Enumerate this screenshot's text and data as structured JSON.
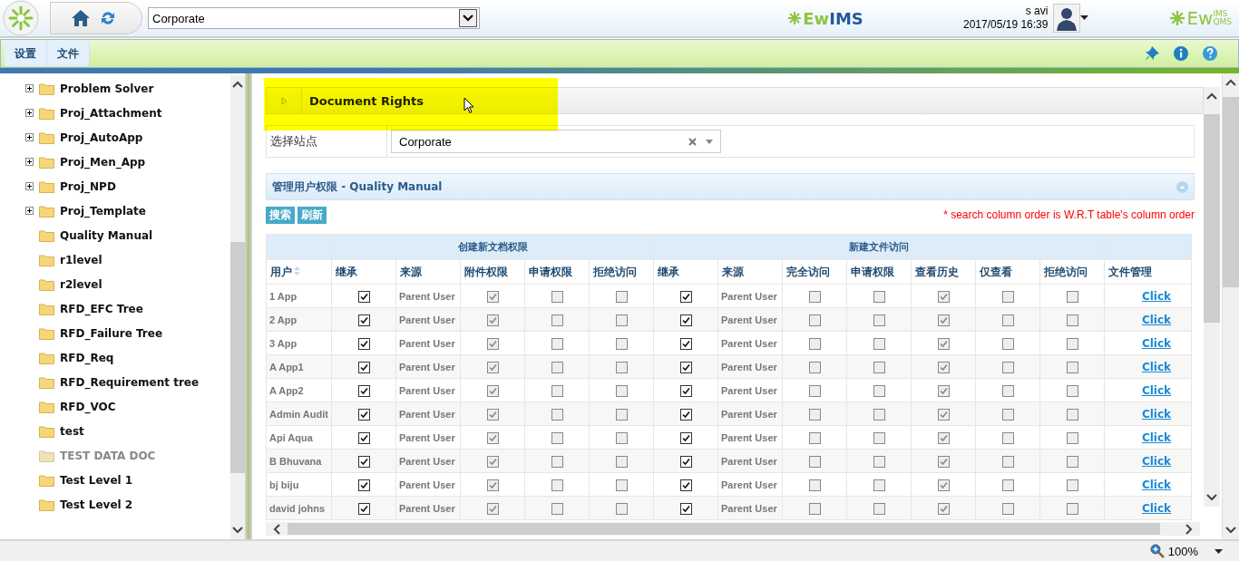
{
  "header": {
    "site_select": "Corporate",
    "user_name": "s avi",
    "datetime": "2017/05/19 16:39"
  },
  "logo_center": {
    "green": "Ew",
    "blue": "IMS"
  },
  "logo_right": {
    "word": "Ew",
    "upper": "IMS",
    "lower": "QMS"
  },
  "menu": [
    {
      "label": "设置"
    },
    {
      "label": "文件"
    }
  ],
  "tree": [
    {
      "label": "Problem Solver",
      "expandable": true,
      "dimmed": false
    },
    {
      "label": "Proj_Attachment",
      "expandable": true,
      "dimmed": false
    },
    {
      "label": "Proj_AutoApp",
      "expandable": true,
      "dimmed": false
    },
    {
      "label": "Proj_Men_App",
      "expandable": true,
      "dimmed": false
    },
    {
      "label": "Proj_NPD",
      "expandable": true,
      "dimmed": false
    },
    {
      "label": "Proj_Template",
      "expandable": true,
      "dimmed": false
    },
    {
      "label": "Quality Manual",
      "expandable": false,
      "dimmed": false
    },
    {
      "label": "r1level",
      "expandable": false,
      "dimmed": false
    },
    {
      "label": "r2level",
      "expandable": false,
      "dimmed": false
    },
    {
      "label": "RFD_EFC Tree",
      "expandable": false,
      "dimmed": false
    },
    {
      "label": "RFD_Failure Tree",
      "expandable": false,
      "dimmed": false
    },
    {
      "label": "RFD_Req",
      "expandable": false,
      "dimmed": false
    },
    {
      "label": "RFD_Requirement tree",
      "expandable": false,
      "dimmed": false
    },
    {
      "label": "RFD_VOC",
      "expandable": false,
      "dimmed": false
    },
    {
      "label": "test",
      "expandable": false,
      "dimmed": false
    },
    {
      "label": "TEST DATA DOC",
      "expandable": false,
      "dimmed": true
    },
    {
      "label": "Test Level 1",
      "expandable": false,
      "dimmed": false
    },
    {
      "label": "Test Level 2",
      "expandable": false,
      "dimmed": false
    }
  ],
  "panel": {
    "title": "Document Rights",
    "highlighted": true
  },
  "site_field": {
    "label": "选择站点",
    "value": "Corporate"
  },
  "section": {
    "title": "管理用户权限 - Quality Manual"
  },
  "buttons": [
    "搜索",
    "刷新"
  ],
  "note": "* search column order is W.R.T table's column order",
  "table": {
    "column_groups": [
      {
        "columns": [
          {
            "label": "用户",
            "kind": "text",
            "sortable": true
          }
        ]
      },
      {
        "label": "创建新文档权限",
        "columns": [
          {
            "label": "继承",
            "kind": "check",
            "disabled": false,
            "sortable": false
          },
          {
            "label": "来源",
            "kind": "text",
            "sortable": false
          },
          {
            "label": "附件权限",
            "kind": "check",
            "disabled": true,
            "sortable": false
          },
          {
            "label": "申请权限",
            "kind": "check",
            "disabled": true,
            "sortable": false
          },
          {
            "label": "拒绝访问",
            "kind": "check",
            "disabled": true,
            "sortable": false
          }
        ]
      },
      {
        "label": "新建文件访问",
        "columns": [
          {
            "label": "继承",
            "kind": "check",
            "disabled": false,
            "sortable": false
          },
          {
            "label": "来源",
            "kind": "text",
            "sortable": false
          },
          {
            "label": "完全访问",
            "kind": "check",
            "disabled": true,
            "sortable": false
          },
          {
            "label": "申请权限",
            "kind": "check",
            "disabled": true,
            "sortable": false
          },
          {
            "label": "查看历史",
            "kind": "check",
            "disabled": true,
            "sortable": false
          },
          {
            "label": "仅查看",
            "kind": "check",
            "disabled": true,
            "sortable": false
          },
          {
            "label": "拒绝访问",
            "kind": "check",
            "disabled": true,
            "sortable": false
          }
        ]
      },
      {
        "columns": [
          {
            "label": "文件管理",
            "kind": "link",
            "sortable": false
          }
        ]
      }
    ],
    "rows": [
      {
        "cells": [
          "1 App",
          true,
          "Parent User",
          true,
          false,
          false,
          true,
          "Parent User",
          false,
          false,
          true,
          false,
          false,
          "Click"
        ]
      },
      {
        "cells": [
          "2 App",
          true,
          "Parent User",
          true,
          false,
          false,
          true,
          "Parent User",
          false,
          false,
          true,
          false,
          false,
          "Click"
        ]
      },
      {
        "cells": [
          "3 App",
          true,
          "Parent User",
          true,
          false,
          false,
          true,
          "Parent User",
          false,
          false,
          true,
          false,
          false,
          "Click"
        ]
      },
      {
        "cells": [
          "A App1",
          true,
          "Parent User",
          true,
          false,
          false,
          true,
          "Parent User",
          false,
          false,
          true,
          false,
          false,
          "Click"
        ]
      },
      {
        "cells": [
          "A App2",
          true,
          "Parent User",
          true,
          false,
          false,
          true,
          "Parent User",
          false,
          false,
          true,
          false,
          false,
          "Click"
        ]
      },
      {
        "cells": [
          "Admin Audit",
          true,
          "Parent User",
          true,
          false,
          false,
          true,
          "Parent User",
          false,
          false,
          true,
          false,
          false,
          "Click"
        ]
      },
      {
        "cells": [
          "Api Aqua",
          true,
          "Parent User",
          true,
          false,
          false,
          true,
          "Parent User",
          false,
          false,
          true,
          false,
          false,
          "Click"
        ]
      },
      {
        "cells": [
          "B Bhuvana",
          true,
          "Parent User",
          true,
          false,
          false,
          true,
          "Parent User",
          false,
          false,
          true,
          false,
          false,
          "Click"
        ]
      },
      {
        "cells": [
          "bj biju",
          true,
          "Parent User",
          true,
          false,
          false,
          true,
          "Parent User",
          false,
          false,
          true,
          false,
          false,
          "Click"
        ]
      },
      {
        "cells": [
          "david johns",
          true,
          "Parent User",
          true,
          false,
          false,
          true,
          "Parent User",
          false,
          false,
          true,
          false,
          false,
          "Click"
        ]
      }
    ]
  },
  "zoom": "100%"
}
